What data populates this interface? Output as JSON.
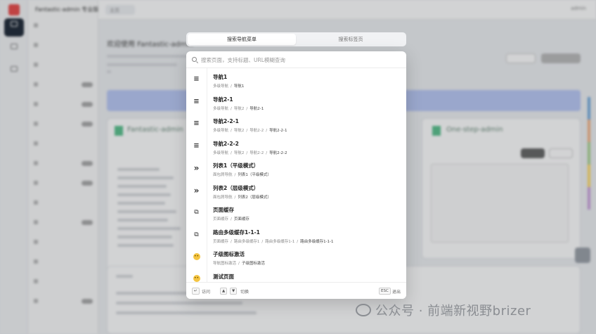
{
  "background": {
    "app_title": "Fantastic-admin 专业版",
    "tab_label": "主页",
    "welcome": "欢迎使用 Fantastic-admin",
    "card_left_title": "Fantastic-admin",
    "card_right_title": "One-step-admin",
    "user": "admin"
  },
  "search": {
    "tabs": [
      {
        "label": "搜索导航菜单",
        "active": true
      },
      {
        "label": "搜索标签页",
        "active": false
      }
    ],
    "placeholder": "搜索页面，支持标题、URL模糊查询",
    "value": "",
    "results": [
      {
        "icon": "menu-icon",
        "title": "导航1",
        "breadcrumb": [
          "多级导航",
          "导航1"
        ]
      },
      {
        "icon": "menu-icon",
        "title": "导航2-1",
        "breadcrumb": [
          "多级导航",
          "导航2",
          "导航2-1"
        ]
      },
      {
        "icon": "menu-icon",
        "title": "导航2-2-1",
        "breadcrumb": [
          "多级导航",
          "导航2",
          "导航2-2",
          "导航2-2-1"
        ]
      },
      {
        "icon": "menu-icon",
        "title": "导航2-2-2",
        "breadcrumb": [
          "多级导航",
          "导航2",
          "导航2-2",
          "导航2-2-2"
        ]
      },
      {
        "icon": "chevrons-right-icon",
        "title": "列表1（平级模式）",
        "breadcrumb": [
          "面包屑导航",
          "列表1（平级模式）"
        ]
      },
      {
        "icon": "chevrons-right-icon",
        "title": "列表2（层级模式）",
        "breadcrumb": [
          "面包屑导航",
          "列表2（层级模式）"
        ]
      },
      {
        "icon": "pages-icon",
        "title": "页面缓存",
        "breadcrumb": [
          "页面缓存",
          "页面缓存"
        ]
      },
      {
        "icon": "pages-icon",
        "title": "路由多级缓存1-1-1",
        "breadcrumb": [
          "页面缓存",
          "路由多级缓存1",
          "路由多级缓存1-1",
          "路由多级缓存1-1-1"
        ]
      },
      {
        "icon": "emoji-icon",
        "title": "子级图标激活",
        "breadcrumb": [
          "导航图标激活",
          "子级图标激活"
        ]
      },
      {
        "icon": "emoji-icon",
        "title": "测试页面",
        "breadcrumb": []
      }
    ],
    "footer": {
      "enter_key": "↵",
      "enter_label": "访问",
      "up_key": "▲",
      "down_key": "▼",
      "switch_label": "切换",
      "esc_key": "ESC",
      "esc_label": "退出"
    }
  },
  "watermark": "公众号 · 前端新视野brizer"
}
